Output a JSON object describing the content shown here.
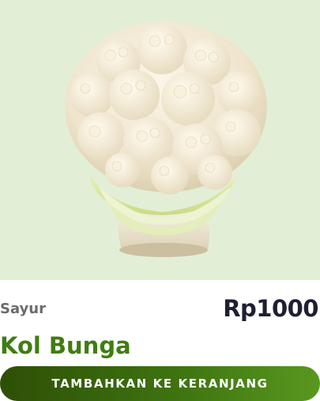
{
  "product": {
    "image": {
      "subject": "cauliflower",
      "background_color": "#e2efd6"
    },
    "category": "Sayur",
    "price": "Rp1000",
    "name": "Kol Bunga"
  },
  "actions": {
    "add_to_cart_label": "TAMBAHKAN KE KERANJANG"
  },
  "colors": {
    "name_green": "#3f7d10",
    "price_dark": "#1f1f33",
    "category_gray": "#6b6b6b",
    "button_gradient_start": "#2e4f06",
    "button_gradient_end": "#58981e"
  }
}
